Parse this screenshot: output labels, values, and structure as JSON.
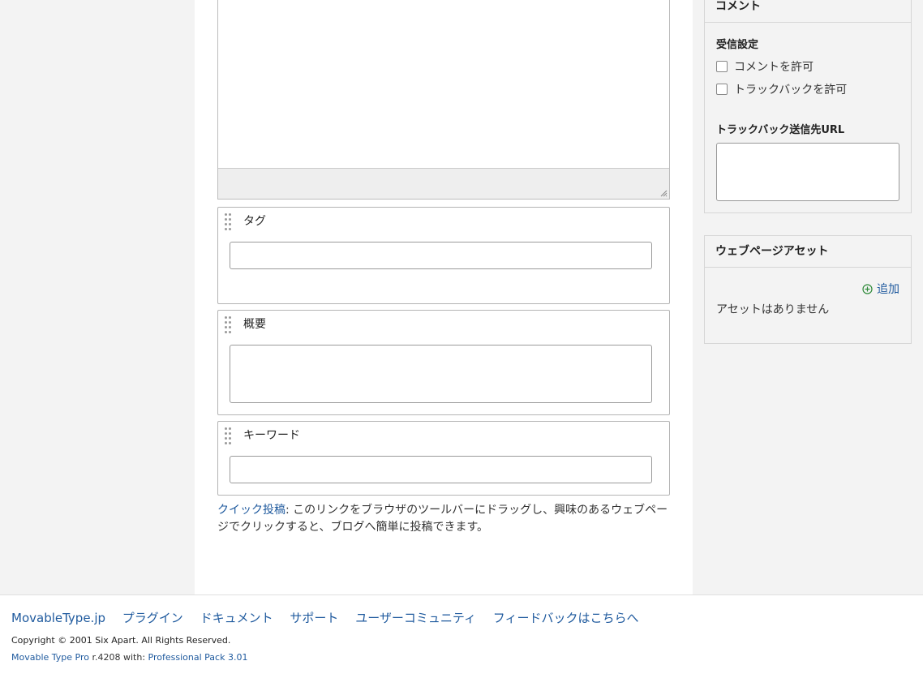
{
  "fields": {
    "tags": {
      "label": "タグ",
      "value": ""
    },
    "excerpt": {
      "label": "概要",
      "value": ""
    },
    "keywords": {
      "label": "キーワード",
      "value": ""
    }
  },
  "quick_post": {
    "link_text": "クイック投稿",
    "description": ": このリンクをブラウザのツールバーにドラッグし、興味のあるウェブページでクリックすると、ブログへ簡単に投稿できます。"
  },
  "sidebar": {
    "comments_panel": {
      "title": "コメント",
      "receive_settings_label": "受信設定",
      "allow_comments_label": "コメントを許可",
      "allow_comments_checked": false,
      "allow_trackbacks_label": "トラックバックを許可",
      "allow_trackbacks_checked": false,
      "trackback_url_label": "トラックバック送信先URL",
      "trackback_url_value": ""
    },
    "assets_panel": {
      "title": "ウェブページアセット",
      "add_label": "追加",
      "empty_text": "アセットはありません"
    }
  },
  "footer": {
    "links": [
      "MovableType.jp",
      "プラグイン",
      "ドキュメント",
      "サポート",
      "ユーザーコミュニティ",
      "フィードバックはこちらへ"
    ],
    "copyright": "Copyright © 2001 Six Apart. All Rights Reserved.",
    "version_product": "Movable Type Pro",
    "version_text": " r.4208 with: ",
    "version_pack": "Professional Pack 3.01"
  },
  "colors": {
    "link": "#1f5a9e",
    "add_icon": "#2f8a3a",
    "background": "#f3f3f3"
  },
  "icons": {
    "add": "plus-circle-icon",
    "drag": "drag-handle-icon"
  }
}
